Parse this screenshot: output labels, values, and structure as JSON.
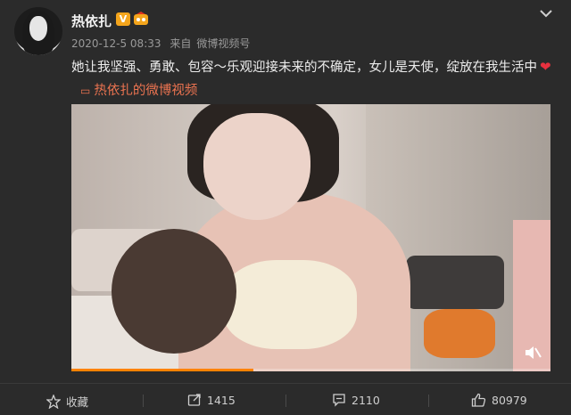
{
  "post": {
    "username": "热依扎",
    "verified_badge": "V",
    "timestamp": "2020-12-5 08:33",
    "source_prefix": "来自",
    "source": "微博视频号",
    "text": "她让我坚强、勇敢、包容～乐观迎接未来的不确定，女儿是天使，绽放在我生活中",
    "heart": "❤",
    "video_link": "热依扎的微博视频"
  },
  "video": {
    "progress": 0.38,
    "muted": true
  },
  "actions": {
    "favorite_label": "收藏",
    "repost_count": "1415",
    "comment_count": "2110",
    "like_count": "80979"
  },
  "colors": {
    "accent_link": "#eb7350",
    "progress": "#ff8200",
    "badge": "#f4a51c"
  },
  "icons": [
    "star-icon",
    "repost-icon",
    "comment-icon",
    "like-icon",
    "mute-icon",
    "chevron-down-icon",
    "video-link-icon"
  ]
}
